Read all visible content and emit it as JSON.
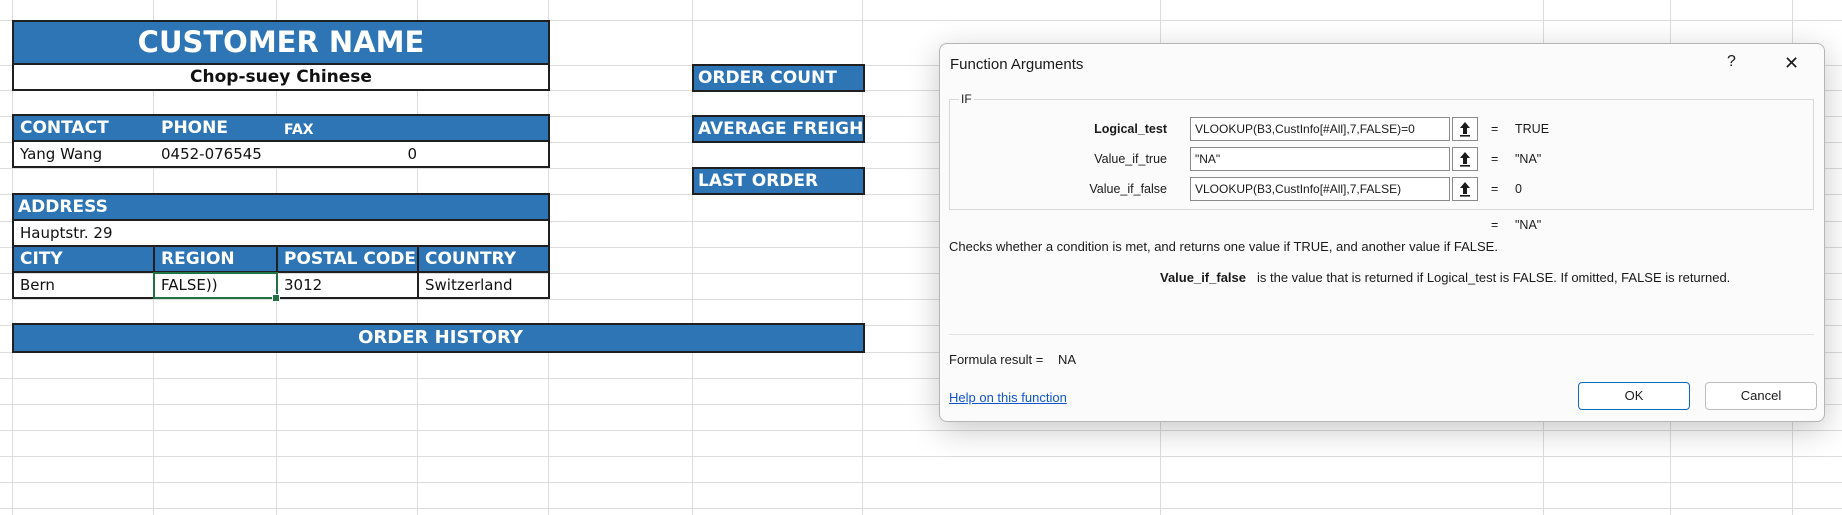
{
  "sheet": {
    "customer_name_header": "CUSTOMER NAME",
    "customer_name": "Chop-suey Chinese",
    "contact_header": "CONTACT",
    "phone_header": "PHONE",
    "fax_header": "FAX",
    "contact_value": "Yang Wang",
    "phone_value": "0452-076545",
    "fax_value": "0",
    "address_header": "ADDRESS",
    "address_value": "Hauptstr. 29",
    "city_header": "CITY",
    "region_header": "REGION",
    "postal_header": "POSTAL CODE",
    "country_header": "COUNTRY",
    "city_value": "Bern",
    "region_value": "FALSE))",
    "postal_value": "3012",
    "country_value": "Switzerland",
    "order_history_header": "ORDER HISTORY",
    "order_count_header": "ORDER COUNT",
    "average_freight_header": "AVERAGE FREIGHT",
    "last_order_header": "LAST ORDER"
  },
  "dialog": {
    "title": "Function Arguments",
    "help_glyph": "?",
    "close_glyph": "✕",
    "function_name": "IF",
    "arguments": [
      {
        "label": "Logical_test",
        "value": "VLOOKUP(B3,CustInfo[#All],7,FALSE)=0",
        "equals": "=",
        "result": "TRUE"
      },
      {
        "label": "Value_if_true",
        "value": "\"NA\"",
        "equals": "=",
        "result": "\"NA\""
      },
      {
        "label": "Value_if_false",
        "value": "VLOOKUP(B3,CustInfo[#All],7,FALSE)",
        "equals": "=",
        "result": "0"
      }
    ],
    "overall_equals": "=",
    "overall_result": "\"NA\"",
    "description": "Checks whether a condition is met, and returns one value if TRUE, and another value if FALSE.",
    "arg_desc_name": "Value_if_false",
    "arg_desc_text": "is the value that is returned if Logical_test is FALSE. If omitted, FALSE is returned.",
    "formula_result_label": "Formula result =",
    "formula_result_value": "NA",
    "help_link": "Help on this function",
    "ok_label": "OK",
    "cancel_label": "Cancel"
  },
  "colors": {
    "header_band": "#2e75b6",
    "selection": "#217346",
    "link": "#1155cc"
  },
  "icons": {
    "collapse_button_icon": "upload-arrow-icon"
  }
}
